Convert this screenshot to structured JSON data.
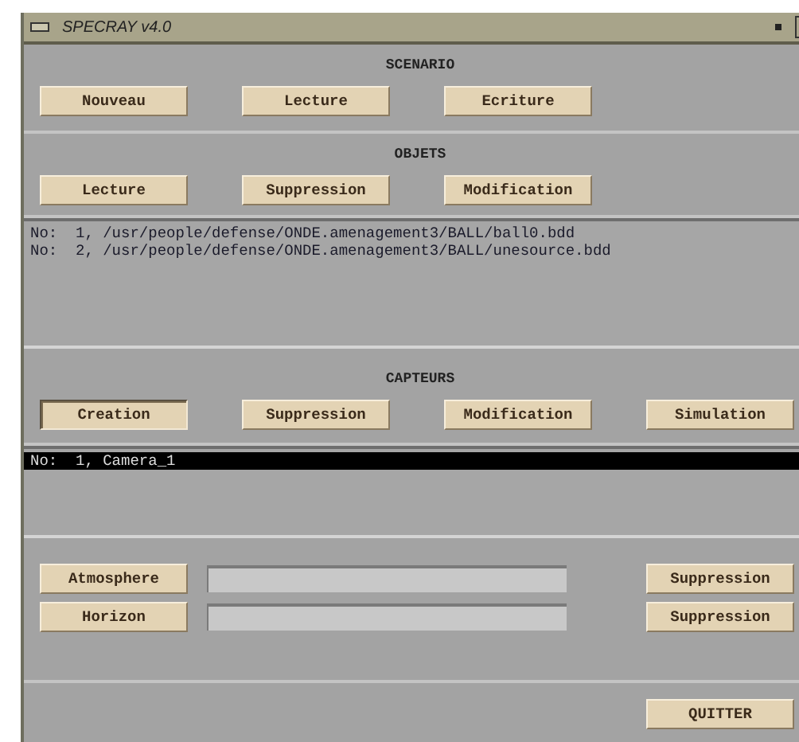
{
  "window": {
    "title": "SPECRAY v4.0"
  },
  "scenario": {
    "heading": "SCENARIO",
    "buttons": [
      {
        "label": "Nouveau",
        "selected": false
      },
      {
        "label": "Lecture",
        "selected": false
      },
      {
        "label": "Ecriture",
        "selected": false
      }
    ]
  },
  "objets": {
    "heading": "OBJETS",
    "buttons": [
      {
        "label": "Lecture",
        "selected": false
      },
      {
        "label": "Suppression",
        "selected": false
      },
      {
        "label": "Modification",
        "selected": false
      }
    ],
    "list": [
      {
        "text": "No:  1, /usr/people/defense/ONDE.amenagement3/BALL/ball0.bdd",
        "selected": false
      },
      {
        "text": "No:  2, /usr/people/defense/ONDE.amenagement3/BALL/unesource.bdd",
        "selected": false
      }
    ]
  },
  "capteurs": {
    "heading": "CAPTEURS",
    "buttons": [
      {
        "label": "Creation",
        "selected": true
      },
      {
        "label": "Suppression",
        "selected": false
      },
      {
        "label": "Modification",
        "selected": false
      },
      {
        "label": "Simulation",
        "selected": false
      }
    ],
    "list": [
      {
        "text": "No:  1, Camera_1",
        "selected": true
      }
    ]
  },
  "settings": [
    {
      "label": "Atmosphere",
      "action": "Suppression"
    },
    {
      "label": "Horizon",
      "action": "Suppression"
    }
  ],
  "quit_button": "QUITTER"
}
